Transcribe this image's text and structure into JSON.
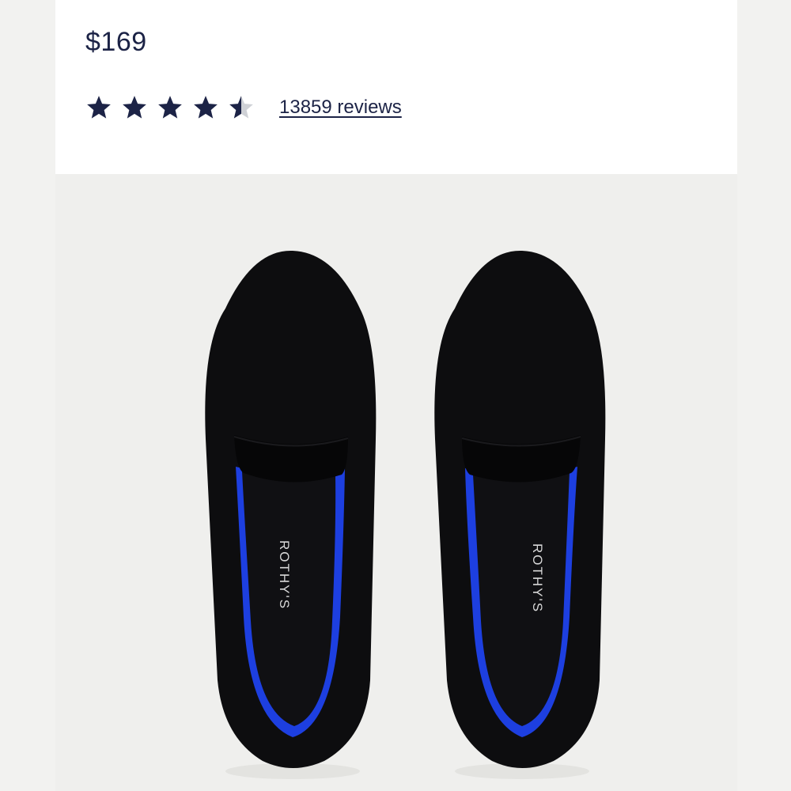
{
  "product": {
    "price": "$169",
    "rating": {
      "value": 4.5,
      "max": 5,
      "reviews_label": "13859 reviews"
    },
    "image": {
      "icon": "shoe-pair-image",
      "brand_imprint_left": "ROTHY'S",
      "brand_imprint_right": "ROTHY'S"
    }
  },
  "colors": {
    "text": "#1c2346",
    "star_filled": "#1c2346",
    "star_empty": "#cfd1d6",
    "shoe": "#0d0d0f",
    "lining": "#1d3fe0",
    "background": "#efefed"
  }
}
